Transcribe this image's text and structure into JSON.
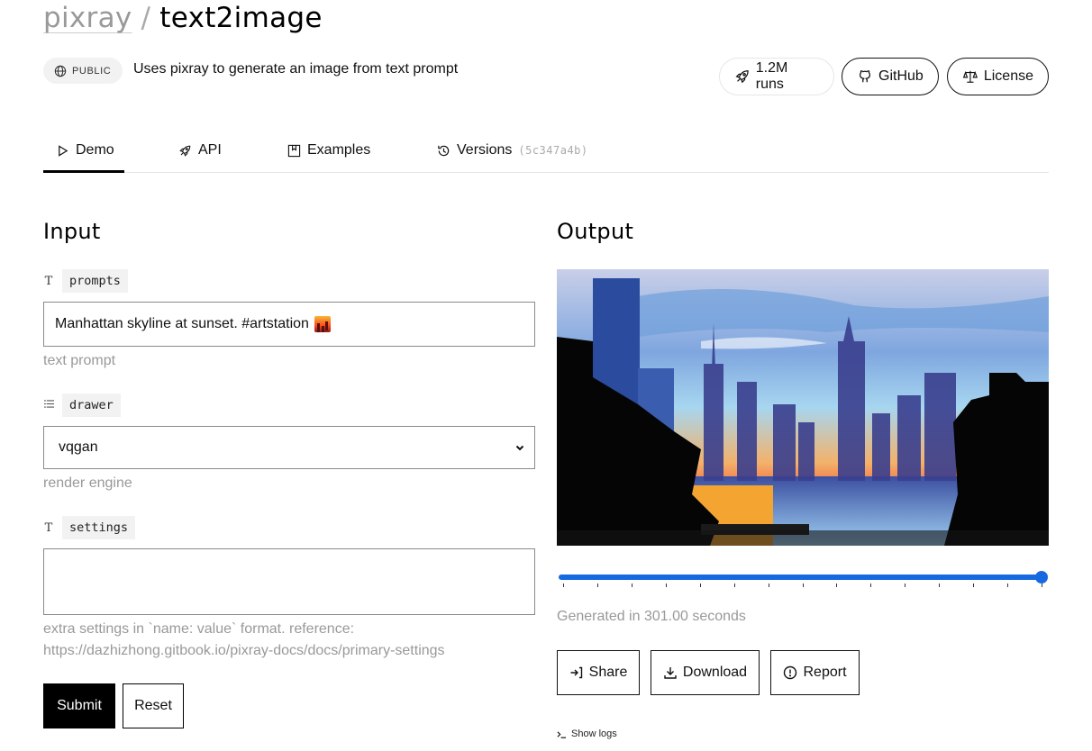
{
  "header": {
    "owner": "pixray",
    "separator": "/",
    "model_name": "text2image",
    "visibility_badge": "PUBLIC",
    "visibility_icon": "globe-icon",
    "description": "Uses pixray to generate an image from text prompt",
    "actions": {
      "runs_label": "1.2M runs",
      "runs_icon": "rocket-icon",
      "github_label": "GitHub",
      "github_icon": "github-icon",
      "license_label": "License",
      "license_icon": "scale-icon"
    }
  },
  "tabs": [
    {
      "label": "Demo",
      "icon": "play-icon",
      "active": true
    },
    {
      "label": "API",
      "icon": "rocket-icon",
      "active": false
    },
    {
      "label": "Examples",
      "icon": "bookmark-icon",
      "active": false
    },
    {
      "label": "Versions",
      "icon": "history-icon",
      "active": false,
      "suffix": "(5c347a4b)"
    }
  ],
  "input": {
    "heading": "Input",
    "fields": {
      "prompts": {
        "name": "prompts",
        "type_icon": "text-type-icon",
        "value": "Manhattan skyline at sunset. #artstation",
        "emoji": "city-sunset-emoji",
        "hint": "text prompt"
      },
      "drawer": {
        "name": "drawer",
        "type_icon": "list-icon",
        "value": "vqgan",
        "hint": "render engine"
      },
      "settings": {
        "name": "settings",
        "type_icon": "text-type-icon",
        "value": "",
        "hint_line1": "extra settings in `name: value` format. reference:",
        "hint_line2": "https://dazhizhong.gitbook.io/pixray-docs/docs/primary-settings"
      }
    },
    "submit_label": "Submit",
    "reset_label": "Reset"
  },
  "output": {
    "heading": "Output",
    "image_alt": "Painted Manhattan skyline at sunset",
    "progress": {
      "current_step": 15,
      "total_steps": 15,
      "fraction": 1.0
    },
    "generated_text": "Generated in 301.00 seconds",
    "share_label": "Share",
    "download_label": "Download",
    "report_label": "Report",
    "show_logs_label": "Show logs"
  },
  "colors": {
    "accent": "#1769e0",
    "primary_button": "#000000",
    "muted_text": "#999999"
  }
}
